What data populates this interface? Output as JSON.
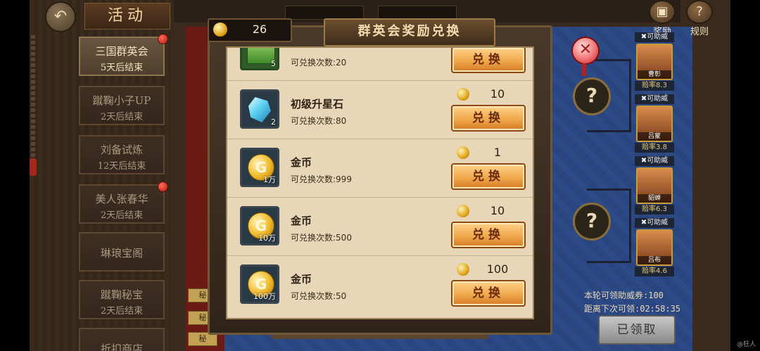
{
  "sidebar": {
    "title": "活动",
    "items": [
      {
        "name": "三国群英会",
        "status": "5天后结束",
        "active": true,
        "dot": true
      },
      {
        "name": "蹴鞠小子UP",
        "status": "2天后结束",
        "active": false,
        "dot": false
      },
      {
        "name": "刘备试炼",
        "status": "12天后结束",
        "active": false,
        "dot": false
      },
      {
        "name": "美人张春华",
        "status": "2天后结束",
        "active": false,
        "dot": true
      },
      {
        "name": "琳琅宝阁",
        "status": "",
        "active": false,
        "dot": false
      },
      {
        "name": "蹴鞠秘宝",
        "status": "2天后结束",
        "active": false,
        "dot": false
      },
      {
        "name": "折扣商店",
        "status": "",
        "active": false,
        "dot": false
      }
    ]
  },
  "topbar": {
    "reward_label": "奖励",
    "rules_label": "规则"
  },
  "heroes": [
    {
      "tag": "可助威",
      "name": "曹彰",
      "rate": "赔率8.3"
    },
    {
      "tag": "可助威",
      "name": "吕蒙",
      "rate": "赔率3.8"
    },
    {
      "tag": "可助威",
      "name": "貂蝉",
      "rate": "赔率6.3"
    },
    {
      "tag": "可助威",
      "name": "吕布",
      "rate": "赔率4.6"
    }
  ],
  "info": {
    "cheer_line": "本轮可领助威券:100",
    "next_line": "距离下次可领:02:58:35",
    "claim_label": "已领取"
  },
  "side_tabs": [
    "秘",
    "秘",
    "秘"
  ],
  "modal": {
    "coin_count": "26",
    "title": "群英会奖励兑换",
    "close_icon": "✕",
    "exchange_label": "兑换",
    "rows": [
      {
        "name": "",
        "count": "5",
        "icon": "book",
        "limit": "可兑换次数:20",
        "price": ""
      },
      {
        "name": "初级升星石",
        "count": "2",
        "icon": "gem",
        "limit": "可兑换次数:80",
        "price": "10"
      },
      {
        "name": "金币",
        "count": "1万",
        "icon": "gold",
        "limit": "可兑换次数:999",
        "price": "1"
      },
      {
        "name": "金币",
        "count": "10万",
        "icon": "gold",
        "limit": "可兑换次数:500",
        "price": "10"
      },
      {
        "name": "金币",
        "count": "100万",
        "icon": "gold",
        "limit": "可兑换次数:50",
        "price": "100"
      }
    ]
  },
  "watermark": "@狂人"
}
